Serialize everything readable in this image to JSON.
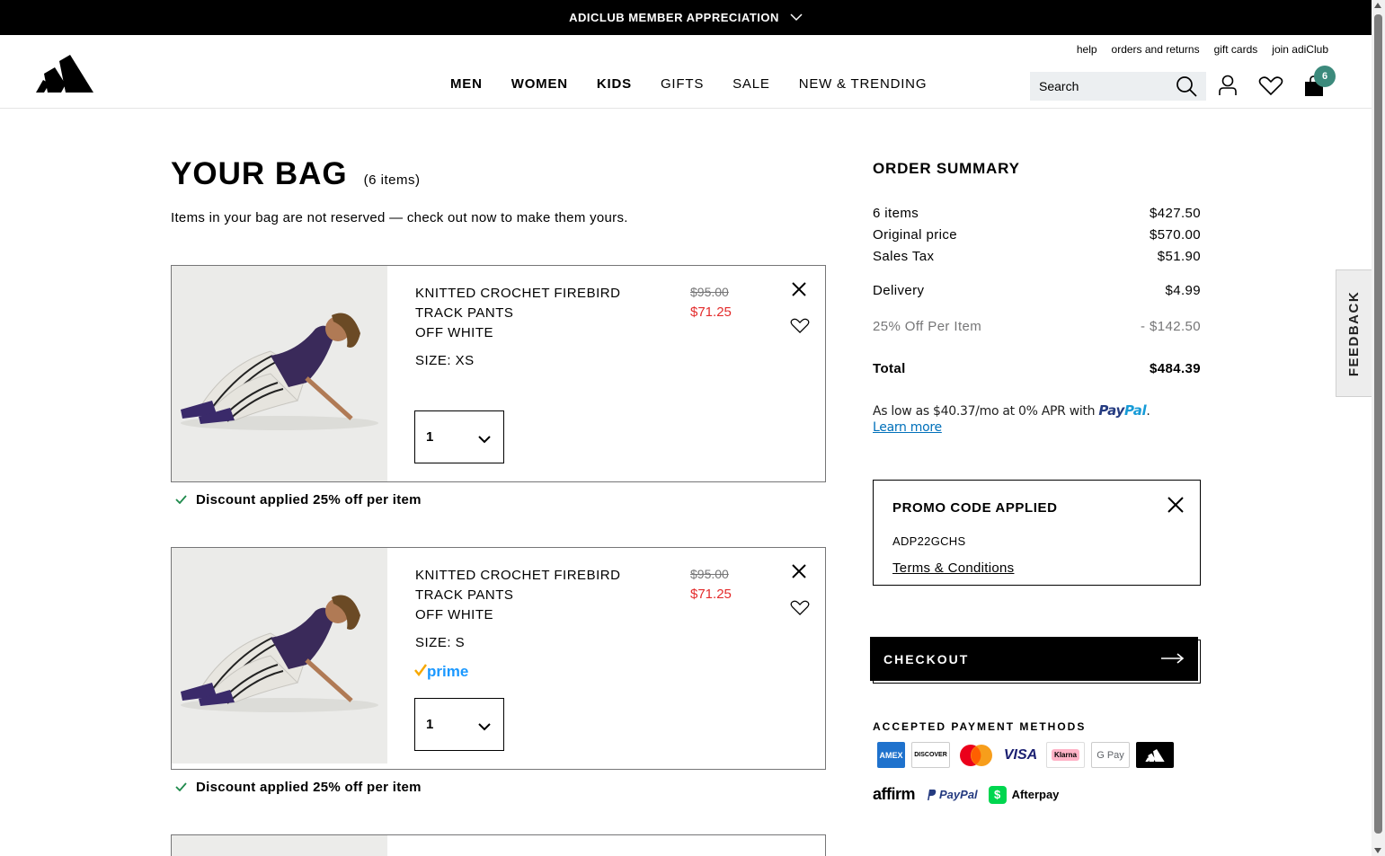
{
  "promo_bar": {
    "text": "ADICLUB MEMBER APPRECIATION"
  },
  "header": {
    "util_links": [
      "help",
      "orders and returns",
      "gift cards",
      "join adiClub"
    ],
    "nav": [
      "MEN",
      "WOMEN",
      "KIDS",
      "GIFTS",
      "SALE",
      "NEW & TRENDING"
    ],
    "search_placeholder": "Search",
    "bag_count": "6"
  },
  "feedback_label": "FEEDBACK",
  "bag": {
    "title": "YOUR BAG",
    "count": "(6 items)",
    "notice": "Items in your bag are not reserved — check out now to make them yours.",
    "items": [
      {
        "name": "KNITTED CROCHET FIREBIRD TRACK PANTS",
        "color": "OFF WHITE",
        "size": "SIZE: XS",
        "price_old": "$95.00",
        "price_new": "$71.25",
        "qty": "1",
        "discount": "Discount applied 25% off per item"
      },
      {
        "name": "KNITTED CROCHET FIREBIRD TRACK PANTS",
        "color": "OFF WHITE",
        "size": "SIZE: S",
        "prime": "prime",
        "price_old": "$95.00",
        "price_new": "$71.25",
        "qty": "1",
        "discount": "Discount applied 25% off per item"
      }
    ]
  },
  "summary": {
    "title": "ORDER SUMMARY",
    "rows": [
      {
        "label": "6 items",
        "value": "$427.50"
      },
      {
        "label": "Original price",
        "value": "$570.00"
      },
      {
        "label": "Sales Tax",
        "value": "$51.90"
      },
      {
        "label": "Delivery",
        "value": "$4.99"
      },
      {
        "label": "25% Off Per Item",
        "value": "- $142.50"
      },
      {
        "label": "Total",
        "value": "$484.39"
      }
    ],
    "paypal_text": "As low as $40.37/mo at 0% APR with",
    "paypal_brand_1": "Pay",
    "paypal_brand_2": "Pal",
    "learn_more": "Learn more"
  },
  "promo": {
    "title": "PROMO CODE APPLIED",
    "code": "ADP22GCHS",
    "terms": "Terms & Conditions"
  },
  "checkout_label": "CHECKOUT",
  "payments": {
    "title": "ACCEPTED PAYMENT METHODS",
    "methods": [
      "AMEX",
      "DISCOVER",
      "Mastercard",
      "VISA",
      "Klarna",
      "G Pay",
      "adidas",
      "affirm",
      "PayPal",
      "Afterpay"
    ]
  }
}
